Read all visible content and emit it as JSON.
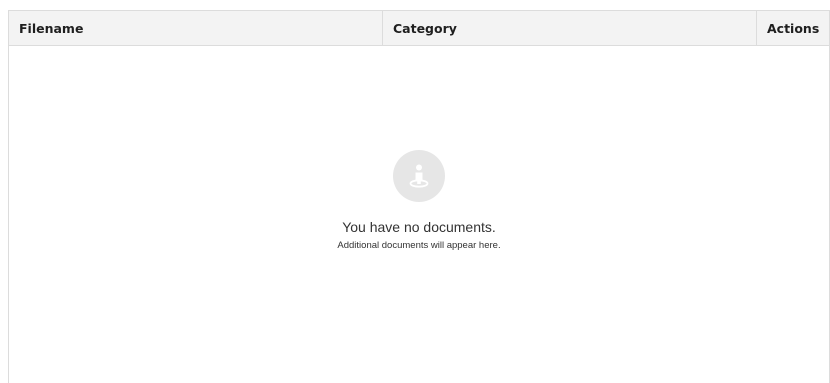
{
  "table": {
    "columns": [
      {
        "label": "Filename"
      },
      {
        "label": "Category"
      },
      {
        "label": "Actions"
      }
    ]
  },
  "empty_state": {
    "icon": "person-pin-icon",
    "title": "You have no documents.",
    "subtitle": "Additional documents will appear here."
  },
  "colors": {
    "header_bg": "#f3f3f3",
    "border": "#dcdcdc",
    "icon_bg": "#e6e6e6",
    "icon_fg": "#ffffff"
  }
}
